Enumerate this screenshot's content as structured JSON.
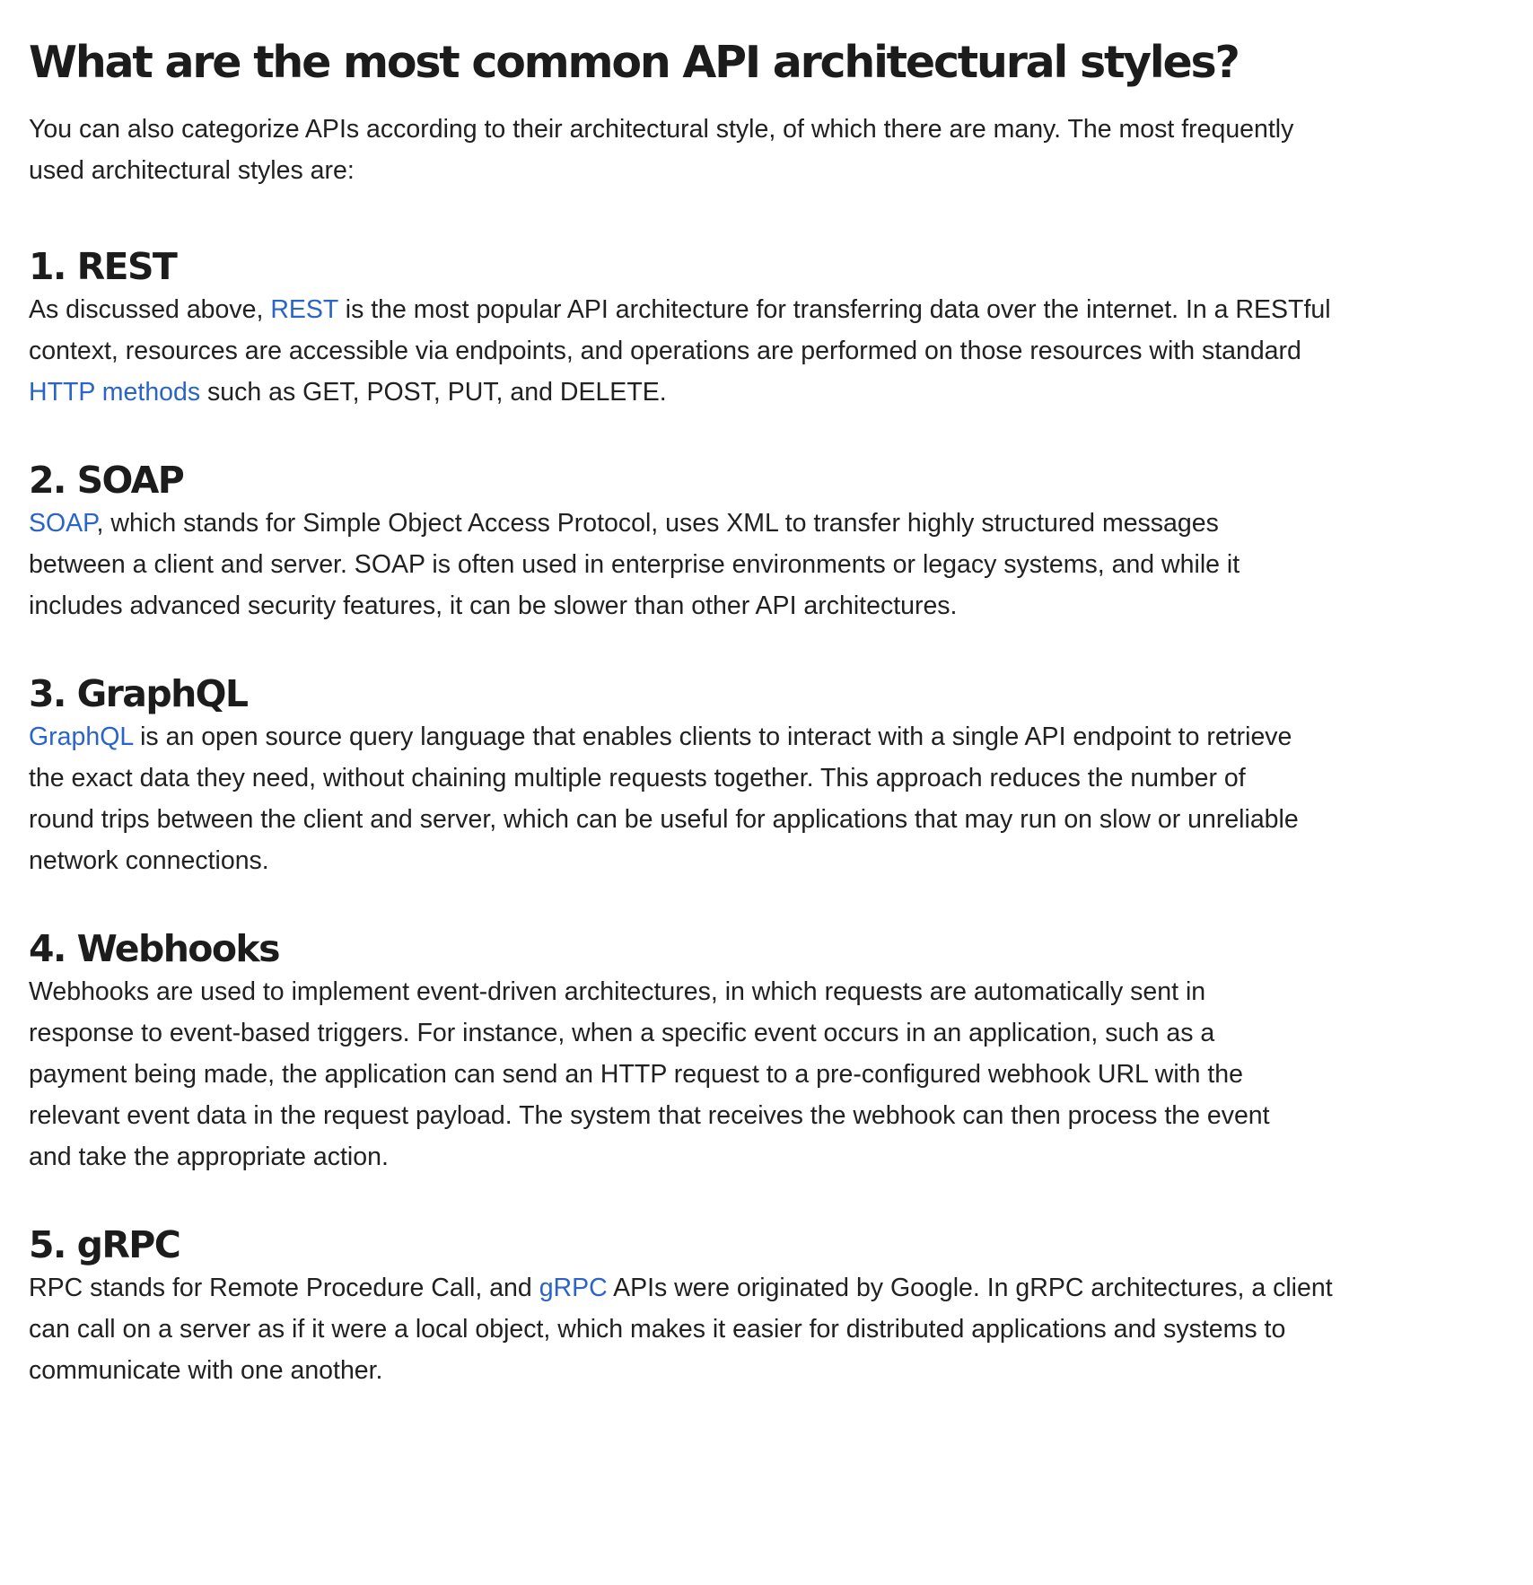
{
  "title": "What are the most common API architectural styles?",
  "intro": {
    "line1": "You can also categorize APIs according to their architectural style, of which there are many. The most frequently",
    "line2": "used architectural styles are:"
  },
  "sections": [
    {
      "heading": "1. REST",
      "lines": [
        {
          "pre": "As discussed above, ",
          "link": "REST",
          "post": " is the most popular API architecture for transferring data over the internet. In a RESTful"
        },
        {
          "pre": "context, resources are accessible via endpoints, and operations are performed on those resources with standard",
          "link": "",
          "post": ""
        },
        {
          "pre": "",
          "link": "HTTP methods",
          "post": " such as GET, POST, PUT, and DELETE."
        }
      ]
    },
    {
      "heading": "2. SOAP",
      "lines": [
        {
          "pre": "",
          "link": "SOAP",
          "post": ", which stands for Simple Object Access Protocol, uses XML to transfer highly structured messages"
        },
        {
          "pre": "between a client and server. SOAP is often used in enterprise environments or legacy systems, and while it",
          "link": "",
          "post": ""
        },
        {
          "pre": "includes advanced security features, it can be slower than other API architectures.",
          "link": "",
          "post": ""
        }
      ]
    },
    {
      "heading": "3. GraphQL",
      "lines": [
        {
          "pre": "",
          "link": "GraphQL",
          "post": " is an open source query language that enables clients to interact with a single API endpoint to retrieve"
        },
        {
          "pre": "the exact data they need, without chaining multiple requests together. This approach reduces the number of",
          "link": "",
          "post": ""
        },
        {
          "pre": "round trips between the client and server, which can be useful for applications that may run on slow or unreliable",
          "link": "",
          "post": ""
        },
        {
          "pre": "network connections.",
          "link": "",
          "post": ""
        }
      ]
    },
    {
      "heading": "4. Webhooks",
      "lines": [
        {
          "pre": "Webhooks are used to implement event-driven architectures, in which requests are automatically sent in",
          "link": "",
          "post": ""
        },
        {
          "pre": "response to event-based triggers. For instance, when a specific event occurs in an application, such as a",
          "link": "",
          "post": ""
        },
        {
          "pre": "payment being made, the application can send an HTTP request to a pre-configured webhook URL with the",
          "link": "",
          "post": ""
        },
        {
          "pre": "relevant event data in the request payload. The system that receives the webhook can then process the event",
          "link": "",
          "post": ""
        },
        {
          "pre": "and take the appropriate action.",
          "link": "",
          "post": ""
        }
      ]
    },
    {
      "heading": "5. gRPC",
      "lines": [
        {
          "pre": "RPC stands for Remote Procedure Call, and ",
          "link": "gRPC",
          "post": " APIs were originated by Google. In gRPC architectures, a client"
        },
        {
          "pre": "can call on a server as if it were a local object, which makes it easier for distributed applications and systems to",
          "link": "",
          "post": ""
        },
        {
          "pre": "communicate with one another.",
          "link": "",
          "post": ""
        }
      ]
    }
  ],
  "colors": {
    "text": "#212121",
    "link": "#2a64c8",
    "background": "#ffffff"
  }
}
